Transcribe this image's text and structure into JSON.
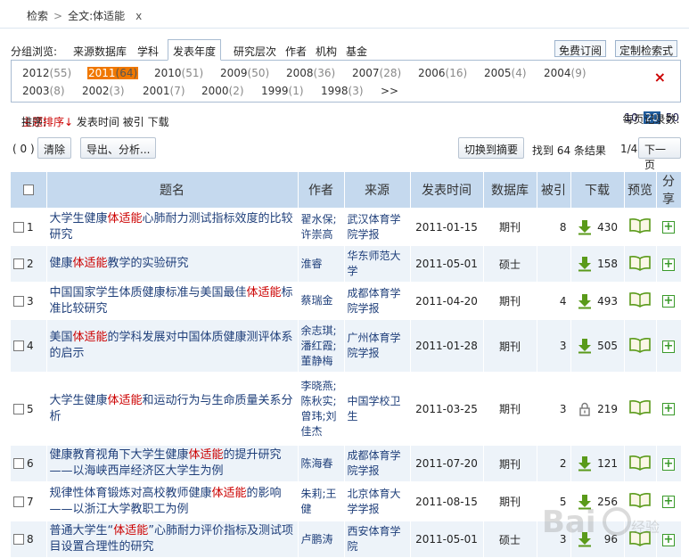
{
  "breadcrumb": {
    "root": "检索",
    "sep": ">",
    "current": "全文:体适能",
    "close": "x"
  },
  "group": {
    "label": "分组浏览:",
    "tabs": [
      "来源数据库",
      "学科",
      "发表年度",
      "研究层次",
      "作者",
      "机构",
      "基金"
    ],
    "active": "发表年度",
    "subscribe": "免费订阅",
    "custom": "定制检索式"
  },
  "years": [
    {
      "y": "2012",
      "c": "(55)"
    },
    {
      "y": "2011",
      "c": "(64)",
      "selected": true
    },
    {
      "y": "2010",
      "c": "(51)"
    },
    {
      "y": "2009",
      "c": "(50)"
    },
    {
      "y": "2008",
      "c": "(36)"
    },
    {
      "y": "2007",
      "c": "(28)"
    },
    {
      "y": "2006",
      "c": "(16)"
    },
    {
      "y": "2005",
      "c": "(4)"
    },
    {
      "y": "2004",
      "c": "(9)"
    },
    {
      "y": "2003",
      "c": "(8)"
    },
    {
      "y": "2002",
      "c": "(3)"
    },
    {
      "y": "2001",
      "c": "(7)"
    },
    {
      "y": "2000",
      "c": "(2)"
    },
    {
      "y": "1999",
      "c": "(1)"
    },
    {
      "y": "1998",
      "c": "(3)"
    }
  ],
  "years_more": ">>",
  "years_close": "×",
  "sort": {
    "label": "排序:",
    "topic": "主题排序↓",
    "date": "发表时间",
    "cited": "被引",
    "download": "下载"
  },
  "perpage": {
    "label": "每页记录数:",
    "opts": [
      "10",
      "20",
      "50"
    ],
    "current": "20"
  },
  "actions": {
    "selected": "( 0 )",
    "clear": "清除",
    "export": "导出、分析...",
    "switch": "切换到摘要",
    "found": "找到 64 条结果",
    "page": "1/4",
    "next": "下一页"
  },
  "headers": [
    "题名",
    "作者",
    "来源",
    "发表时间",
    "数据库",
    "被引",
    "下载",
    "预览",
    "分享"
  ],
  "rows": [
    {
      "n": "1",
      "pre": "大学生健康",
      "hl": "体适能",
      "post": "心肺耐力测试指标效度的比较研究",
      "author": "翟水保;许崇高",
      "source": "武汉体育学院学报",
      "date": "2011-01-15",
      "db": "期刊",
      "cited": "8",
      "dl": "430",
      "locked": false
    },
    {
      "n": "2",
      "pre": "健康",
      "hl": "体适能",
      "post": "教学的实验研究",
      "author": "淮睿",
      "source": "华东师范大学",
      "date": "2011-05-01",
      "db": "硕士",
      "cited": "",
      "dl": "158",
      "locked": false
    },
    {
      "n": "3",
      "pre": "中国国家学生体质健康标准与美国最佳",
      "hl": "体适能",
      "post": "标准比较研究",
      "author": "蔡瑞金",
      "source": "成都体育学院学报",
      "date": "2011-04-20",
      "db": "期刊",
      "cited": "4",
      "dl": "493",
      "locked": false
    },
    {
      "n": "4",
      "pre": "美国",
      "hl": "体适能",
      "post": "的学科发展对中国体质健康测评体系的启示",
      "author": "余志琪;潘红霞;董静梅",
      "source": "广州体育学院学报",
      "date": "2011-01-28",
      "db": "期刊",
      "cited": "3",
      "dl": "505",
      "locked": false
    },
    {
      "n": "5",
      "pre": "大学生健康",
      "hl": "体适能",
      "post": "和运动行为与生命质量关系分析",
      "author": "李晓燕;陈秋实;曾玮;刘佳杰",
      "source": "中国学校卫生",
      "date": "2011-03-25",
      "db": "期刊",
      "cited": "3",
      "dl": "219",
      "locked": true
    },
    {
      "n": "6",
      "pre": "健康教育视角下大学生健康",
      "hl": "体适能",
      "post": "的提升研究——以海峡西岸经济区大学生为例",
      "author": "陈海春",
      "source": "成都体育学院学报",
      "date": "2011-07-20",
      "db": "期刊",
      "cited": "2",
      "dl": "121",
      "locked": false
    },
    {
      "n": "7",
      "pre": "规律性体育锻炼对高校教师健康",
      "hl": "体适能",
      "post": "的影响——以浙江大学教职工为例",
      "author": "朱莉;王健",
      "source": "北京体育大学学报",
      "date": "2011-08-15",
      "db": "期刊",
      "cited": "5",
      "dl": "256",
      "locked": false
    },
    {
      "n": "8",
      "pre": "普通大学生“",
      "hl": "体适能",
      "post": "”心肺耐力评价指标及测试项目设置合理性的研究",
      "author": "卢鹏涛",
      "source": "西安体育学院",
      "date": "2011-05-01",
      "db": "硕士",
      "cited": "3",
      "dl": "96",
      "locked": false
    }
  ],
  "colors": {
    "accent": "#c00000",
    "header": "#c5d9ee",
    "rowalt": "#edf3f9",
    "download": "#5a9a1a",
    "selectedYear": "#f07800"
  },
  "watermark": "Baidu经验"
}
